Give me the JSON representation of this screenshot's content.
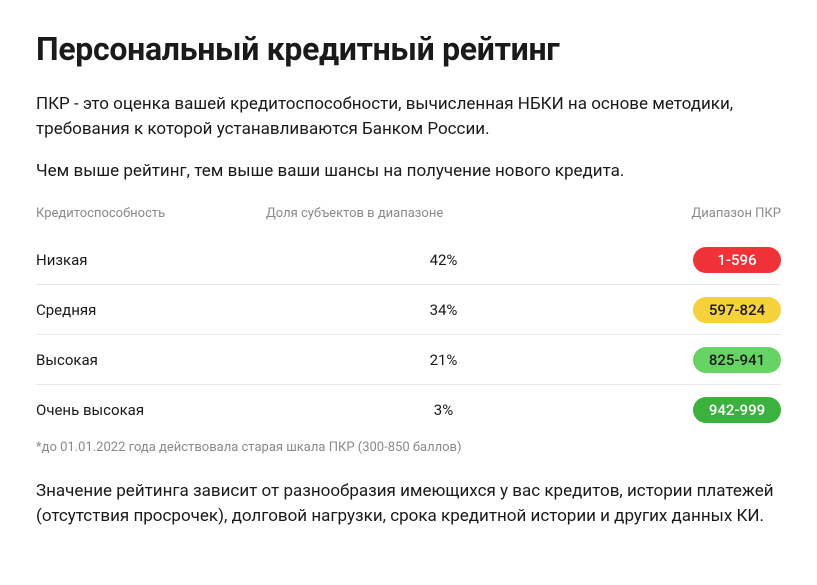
{
  "title": "Персональный кредитный рейтинг",
  "intro1": "ПКР - это оценка вашей кредитоспособности, вычисленная НБКИ на основе методики, требования к которой устанавливаются Банком России.",
  "intro2": "Чем выше рейтинг, тем выше ваши шансы на получение нового кредита.",
  "table": {
    "headers": {
      "credit": "Кредитоспособность",
      "share": "Доля субъектов в диапазоне",
      "range": "Диапазон ПКР"
    },
    "rows": [
      {
        "credit": "Низкая",
        "share": "42%",
        "range": "1-596",
        "color": "#f03238",
        "textLight": true
      },
      {
        "credit": "Средняя",
        "share": "34%",
        "range": "597-824",
        "color": "#f6d23a",
        "textLight": false
      },
      {
        "credit": "Высокая",
        "share": "21%",
        "range": "825-941",
        "color": "#66d464",
        "textLight": false
      },
      {
        "credit": "Очень высокая",
        "share": "3%",
        "range": "942-999",
        "color": "#3bb13e",
        "textLight": true
      }
    ]
  },
  "footnote": "*до 01.01.2022 года действовала старая шкала ПКР (300-850 баллов)",
  "outro": "Значение рейтинга зависит от разнообразия имеющихся у вас кредитов, истории платежей (отсутствия просрочек), долговой нагрузки, срока кредитной истории и других данных КИ."
}
